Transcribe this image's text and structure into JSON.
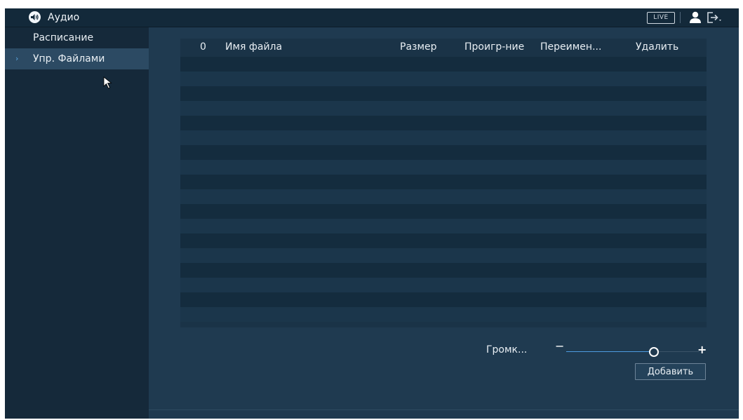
{
  "header": {
    "title": "Аудио",
    "live_label": "LIVE",
    "icons": {
      "title": "speaker-icon",
      "user": "user-icon",
      "logout": "logout-icon"
    }
  },
  "sidebar": {
    "items": [
      {
        "label": "Расписание",
        "active": false
      },
      {
        "label": "Упр. Файлами",
        "active": true
      }
    ]
  },
  "file_table": {
    "columns": [
      "0",
      "Имя файла",
      "Размер",
      "Проигр-ние",
      "Переимен...",
      "Удалить"
    ],
    "rows": []
  },
  "volume": {
    "label": "Громк...",
    "minus_label": "−",
    "plus_label": "+",
    "level": 0.65
  },
  "actions": {
    "add_label": "Добавить"
  },
  "colors": {
    "background": "#1f3a50",
    "sidebar": "#15293a",
    "active_item": "#2c4a63",
    "accent": "#4d9be0"
  }
}
